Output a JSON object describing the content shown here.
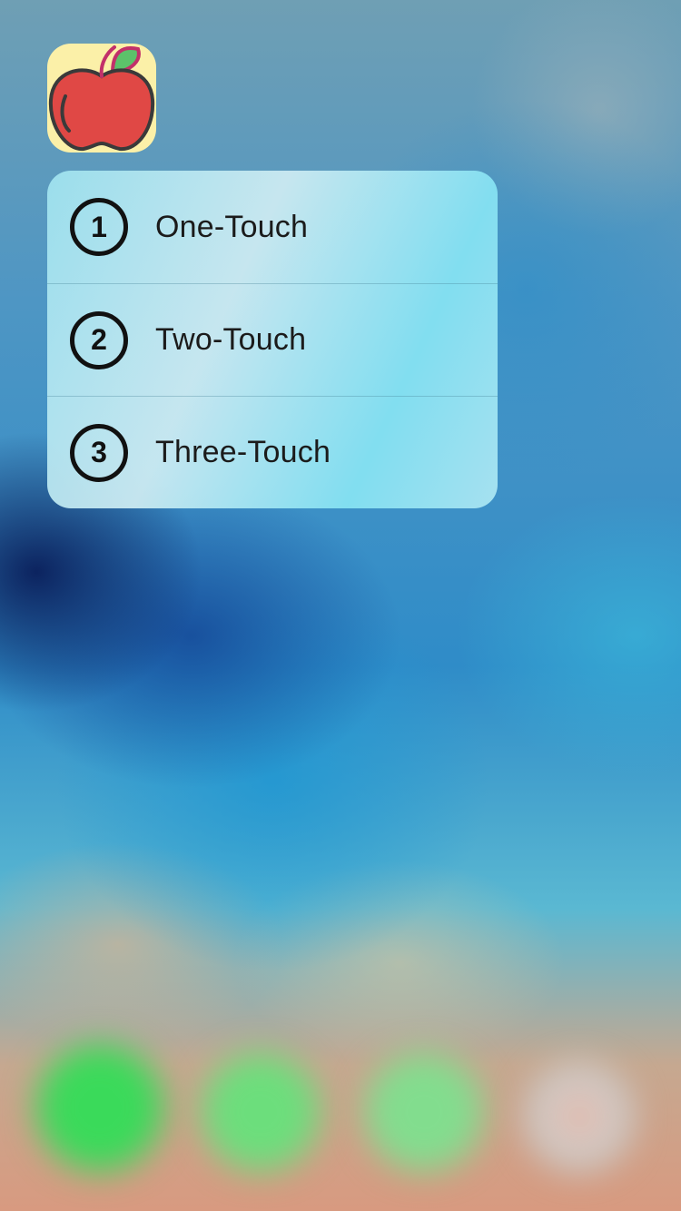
{
  "app_icon": {
    "icon": "apple-icon",
    "background": "#fbf0a8",
    "fruit_color": "#e04845",
    "leaf_color": "#5cc26a"
  },
  "quick_actions": [
    {
      "number": "1",
      "label": "One-Touch"
    },
    {
      "number": "2",
      "label": "Two-Touch"
    },
    {
      "number": "3",
      "label": "Three-Touch"
    }
  ],
  "dock": {
    "icons": [
      "phone-icon",
      "messages-icon",
      "facetime-icon",
      "photos-icon"
    ]
  }
}
